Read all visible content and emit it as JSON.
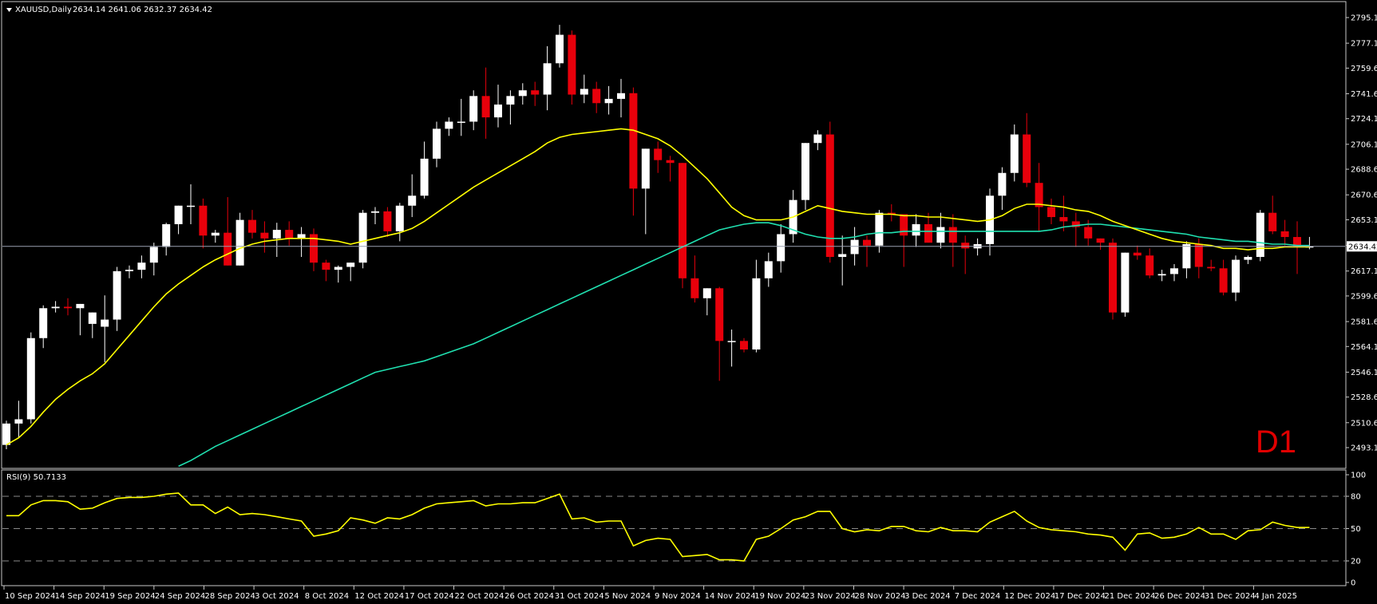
{
  "header": {
    "symbol_tf": "XAUUSD,Daily",
    "ohlc": "2634.14 2641.06 2632.37 2634.42"
  },
  "timeframe_badge": "D1",
  "current_price_label": "2634.42",
  "rsi_header": "RSI(9) 50.7133",
  "colors": {
    "background": "#000000",
    "frame": "#c8c8c8",
    "bull": "#ffffff",
    "bear": "#e8000b",
    "ma_fast": "#ffff00",
    "ma_slow": "#20e0b0",
    "rsi": "#ffff00",
    "badge": "#e00000"
  },
  "price_axis_labels": [
    "2795.10",
    "2777.10",
    "2759.60",
    "2741.60",
    "2724.10",
    "2706.10",
    "2688.60",
    "2670.60",
    "2653.10",
    "2635.10",
    "2617.10",
    "2599.60",
    "2581.60",
    "2564.10",
    "2546.10",
    "2528.60",
    "2510.60",
    "2493.10"
  ],
  "rsi_axis_labels": [
    "100",
    "80",
    "50",
    "20",
    "0"
  ],
  "time_axis_labels": [
    "10 Sep 2024",
    "14 Sep 2024",
    "19 Sep 2024",
    "24 Sep 2024",
    "28 Sep 2024",
    "3 Oct 2024",
    "8 Oct 2024",
    "12 Oct 2024",
    "17 Oct 2024",
    "22 Oct 2024",
    "26 Oct 2024",
    "31 Oct 2024",
    "5 Nov 2024",
    "9 Nov 2024",
    "14 Nov 2024",
    "19 Nov 2024",
    "23 Nov 2024",
    "28 Nov 2024",
    "3 Dec 2024",
    "7 Dec 2024",
    "12 Dec 2024",
    "17 Dec 2024",
    "21 Dec 2024",
    "26 Dec 2024",
    "31 Dec 2024",
    "4 Jan 2025"
  ],
  "chart_data": {
    "type": "candlestick",
    "symbol": "XAUUSD",
    "timeframe": "Daily",
    "price_range": [
      2493.1,
      2803
    ],
    "current_price": 2634.42,
    "candles": [
      [
        2495.0,
        2512.0,
        2492.0,
        2510.0
      ],
      [
        2510.0,
        2526.0,
        2500.0,
        2513.0
      ],
      [
        2513.0,
        2574.0,
        2510.0,
        2570.0
      ],
      [
        2570.0,
        2593.0,
        2563.0,
        2591.0
      ],
      [
        2591.0,
        2596.0,
        2588.0,
        2592.0
      ],
      [
        2592.0,
        2598.0,
        2586.0,
        2591.0
      ],
      [
        2591.0,
        2580.0,
        2572.0,
        2594.0
      ],
      [
        2580.0,
        2578.0,
        2570.0,
        2588.0
      ],
      [
        2578.0,
        2600.0,
        2553.0,
        2583.0
      ],
      [
        2583.0,
        2620.0,
        2575.0,
        2617.0
      ],
      [
        2617.0,
        2621.0,
        2612.0,
        2618.0
      ],
      [
        2618.0,
        2628.0,
        2612.0,
        2623.0
      ],
      [
        2623.0,
        2637.0,
        2614.0,
        2634.0
      ],
      [
        2634.0,
        2651.0,
        2628.0,
        2650.0
      ],
      [
        2650.0,
        2662.0,
        2643.0,
        2663.0
      ],
      [
        2663.0,
        2678.0,
        2650.0,
        2663.0
      ],
      [
        2663.0,
        2668.0,
        2633.0,
        2642.0
      ],
      [
        2642.0,
        2646.0,
        2637.0,
        2644.0
      ],
      [
        2644.0,
        2669.0,
        2630.0,
        2621.0
      ],
      [
        2621.0,
        2658.0,
        2624.0,
        2653.0
      ],
      [
        2653.0,
        2660.0,
        2640.0,
        2644.0
      ],
      [
        2644.0,
        2652.0,
        2630.0,
        2640.0
      ],
      [
        2640.0,
        2651.0,
        2627.0,
        2646.0
      ],
      [
        2646.0,
        2652.0,
        2635.0,
        2640.0
      ],
      [
        2640.0,
        2648.0,
        2627.0,
        2643.0
      ],
      [
        2643.0,
        2647.0,
        2617.0,
        2623.0
      ],
      [
        2623.0,
        2625.0,
        2610.0,
        2618.0
      ],
      [
        2618.0,
        2621.0,
        2609.0,
        2620.0
      ],
      [
        2620.0,
        2621.0,
        2610.0,
        2623.0
      ],
      [
        2623.0,
        2660.0,
        2619.0,
        2658.0
      ],
      [
        2658.0,
        2662.0,
        2650.0,
        2659.0
      ],
      [
        2659.0,
        2662.0,
        2641.0,
        2645.0
      ],
      [
        2645.0,
        2665.0,
        2638.0,
        2663.0
      ],
      [
        2663.0,
        2685.0,
        2655.0,
        2670.0
      ],
      [
        2670.0,
        2708.0,
        2668.0,
        2696.0
      ],
      [
        2696.0,
        2722.0,
        2690.0,
        2717.0
      ],
      [
        2717.0,
        2725.0,
        2712.0,
        2722.0
      ],
      [
        2722.0,
        2738.0,
        2712.0,
        2722.0
      ],
      [
        2722.0,
        2744.0,
        2716.0,
        2740.0
      ],
      [
        2740.0,
        2760.0,
        2710.0,
        2725.0
      ],
      [
        2725.0,
        2748.0,
        2718.0,
        2734.0
      ],
      [
        2734.0,
        2744.0,
        2720.0,
        2740.0
      ],
      [
        2740.0,
        2749.0,
        2734.0,
        2744.0
      ],
      [
        2744.0,
        2750.0,
        2733.0,
        2741.0
      ],
      [
        2741.0,
        2775.0,
        2730.0,
        2763.0
      ],
      [
        2763.0,
        2790.0,
        2760.0,
        2783.0
      ],
      [
        2783.0,
        2786.0,
        2734.0,
        2741.0
      ],
      [
        2741.0,
        2755.0,
        2735.0,
        2745.0
      ],
      [
        2745.0,
        2750.0,
        2728.0,
        2735.0
      ],
      [
        2735.0,
        2747.0,
        2727.0,
        2738.0
      ],
      [
        2738.0,
        2752.0,
        2725.0,
        2742.0
      ],
      [
        2742.0,
        2746.0,
        2656.0,
        2675.0
      ],
      [
        2675.0,
        2701.0,
        2643.0,
        2703.0
      ],
      [
        2703.0,
        2708.0,
        2686.0,
        2695.0
      ],
      [
        2695.0,
        2698.0,
        2680.0,
        2693.0
      ],
      [
        2693.0,
        2690.0,
        2605.0,
        2612.0
      ],
      [
        2612.0,
        2628.0,
        2595.0,
        2598.0
      ],
      [
        2598.0,
        2602.0,
        2586.0,
        2605.0
      ],
      [
        2605.0,
        2606.0,
        2540.0,
        2568.0
      ],
      [
        2568.0,
        2576.0,
        2550.0,
        2568.0
      ],
      [
        2568.0,
        2570.0,
        2560.0,
        2562.0
      ],
      [
        2562.0,
        2625.0,
        2560.0,
        2612.0
      ],
      [
        2612.0,
        2630.0,
        2606.0,
        2624.0
      ],
      [
        2624.0,
        2650.0,
        2616.0,
        2643.0
      ],
      [
        2643.0,
        2674.0,
        2637.0,
        2667.0
      ],
      [
        2667.0,
        2705.0,
        2660.0,
        2707.0
      ],
      [
        2707.0,
        2716.0,
        2702.0,
        2713.0
      ],
      [
        2713.0,
        2722.0,
        2623.0,
        2627.0
      ],
      [
        2627.0,
        2642.0,
        2607.0,
        2629.0
      ],
      [
        2629.0,
        2648.0,
        2621.0,
        2639.0
      ],
      [
        2639.0,
        2642.0,
        2620.0,
        2635.0
      ],
      [
        2635.0,
        2660.0,
        2630.0,
        2658.0
      ],
      [
        2658.0,
        2664.0,
        2652.0,
        2657.0
      ],
      [
        2657.0,
        2651.0,
        2620.0,
        2642.0
      ],
      [
        2642.0,
        2657.0,
        2634.0,
        2650.0
      ],
      [
        2650.0,
        2658.0,
        2640.0,
        2637.0
      ],
      [
        2637.0,
        2658.0,
        2633.0,
        2648.0
      ],
      [
        2648.0,
        2657.0,
        2620.0,
        2637.0
      ],
      [
        2637.0,
        2642.0,
        2615.0,
        2633.0
      ],
      [
        2633.0,
        2640.0,
        2628.0,
        2636.0
      ],
      [
        2636.0,
        2675.0,
        2628.0,
        2670.0
      ],
      [
        2670.0,
        2690.0,
        2660.0,
        2686.0
      ],
      [
        2686.0,
        2720.0,
        2680.0,
        2713.0
      ],
      [
        2713.0,
        2728.0,
        2676.0,
        2679.0
      ],
      [
        2679.0,
        2693.0,
        2645.0,
        2662.0
      ],
      [
        2662.0,
        2668.0,
        2650.0,
        2655.0
      ],
      [
        2655.0,
        2670.0,
        2645.0,
        2652.0
      ],
      [
        2652.0,
        2658.0,
        2634.0,
        2648.0
      ],
      [
        2648.0,
        2653.0,
        2635.0,
        2640.0
      ],
      [
        2640.0,
        2640.0,
        2632.0,
        2637.0
      ],
      [
        2637.0,
        2640.0,
        2583.0,
        2588.0
      ],
      [
        2588.0,
        2630.0,
        2585.0,
        2630.0
      ],
      [
        2630.0,
        2635.0,
        2625.0,
        2628.0
      ],
      [
        2628.0,
        2633.0,
        2612.0,
        2614.0
      ],
      [
        2614.0,
        2618.0,
        2610.0,
        2615.0
      ],
      [
        2615.0,
        2622.0,
        2610.0,
        2619.0
      ],
      [
        2619.0,
        2638.0,
        2612.0,
        2636.0
      ],
      [
        2636.0,
        2640.0,
        2612.0,
        2620.0
      ],
      [
        2620.0,
        2625.0,
        2617.0,
        2619.0
      ],
      [
        2619.0,
        2625.0,
        2600.0,
        2602.0
      ],
      [
        2602.0,
        2628.0,
        2596.0,
        2625.0
      ],
      [
        2625.0,
        2628.0,
        2622.0,
        2627.0
      ],
      [
        2627.0,
        2660.0,
        2624.0,
        2658.0
      ],
      [
        2658.0,
        2670.0,
        2643.0,
        2645.0
      ],
      [
        2645.0,
        2653.0,
        2635.0,
        2641.0
      ],
      [
        2641.0,
        2652.0,
        2615.0,
        2634.0
      ],
      [
        2634.14,
        2641.06,
        2632.37,
        2634.42
      ]
    ],
    "ma_fast_values": [
      2495,
      2500,
      2508,
      2518,
      2527,
      2534,
      2540,
      2545,
      2552,
      2562,
      2572,
      2582,
      2592,
      2601,
      2608,
      2614,
      2620,
      2625,
      2629,
      2633,
      2636,
      2638,
      2639,
      2640,
      2640,
      2640,
      2639,
      2638,
      2636,
      2638,
      2640,
      2642,
      2644,
      2647,
      2652,
      2658,
      2664,
      2670,
      2676,
      2681,
      2686,
      2691,
      2696,
      2701,
      2707,
      2711,
      2713,
      2714,
      2715,
      2716,
      2717,
      2716,
      2713,
      2710,
      2705,
      2698,
      2690,
      2682,
      2672,
      2662,
      2656,
      2653,
      2653,
      2653,
      2655,
      2659,
      2663,
      2661,
      2659,
      2658,
      2657,
      2657,
      2657,
      2656,
      2656,
      2655,
      2655,
      2654,
      2653,
      2652,
      2653,
      2656,
      2661,
      2664,
      2664,
      2663,
      2662,
      2660,
      2659,
      2656,
      2652,
      2649,
      2646,
      2643,
      2640,
      2638,
      2637,
      2636,
      2635,
      2633,
      2633,
      2632,
      2633,
      2633,
      2634,
      2634,
      2634
    ],
    "ma_slow_values": [
      2480,
      2484,
      2489,
      2494,
      2498,
      2502,
      2506,
      2510,
      2514,
      2518,
      2522,
      2526,
      2530,
      2534,
      2538,
      2542,
      2546,
      2548,
      2550,
      2552,
      2554,
      2557,
      2560,
      2563,
      2566,
      2570,
      2574,
      2578,
      2582,
      2586,
      2590,
      2594,
      2598,
      2602,
      2606,
      2610,
      2614,
      2618,
      2622,
      2626,
      2630,
      2634,
      2638,
      2642,
      2646,
      2648,
      2650,
      2651,
      2651,
      2649,
      2646,
      2643,
      2641,
      2640,
      2640,
      2641,
      2643,
      2644,
      2644,
      2645,
      2645,
      2645,
      2645,
      2645,
      2645,
      2645,
      2645,
      2645,
      2645,
      2645,
      2645,
      2646,
      2648,
      2649,
      2650,
      2650,
      2649,
      2648,
      2647,
      2646,
      2645,
      2644,
      2643,
      2641,
      2640,
      2639,
      2638,
      2638,
      2637,
      2636,
      2636,
      2635,
      2635
    ],
    "rsi": {
      "period": 9,
      "value": 50.7133,
      "levels": [
        20,
        50,
        80
      ],
      "range": [
        0,
        100
      ],
      "values": [
        62,
        62,
        72,
        76,
        76,
        75,
        68,
        69,
        74,
        78,
        79,
        79,
        80,
        82,
        83,
        72,
        72,
        64,
        70,
        63,
        64,
        63,
        61,
        59,
        57,
        43,
        45,
        48,
        60,
        58,
        55,
        60,
        59,
        63,
        69,
        73,
        74,
        75,
        76,
        71,
        73,
        73,
        74,
        74,
        78,
        82,
        59,
        60,
        56,
        57,
        57,
        34,
        39,
        41,
        40,
        24,
        25,
        26,
        21,
        21,
        20,
        40,
        43,
        50,
        58,
        61,
        66,
        66,
        50,
        47,
        49,
        48,
        52,
        52,
        48,
        47,
        51,
        48,
        48,
        47,
        56,
        61,
        66,
        57,
        51,
        49,
        48,
        47,
        45,
        44,
        42,
        30,
        45,
        46,
        41,
        42,
        45,
        51,
        45,
        45,
        40,
        48,
        49,
        56,
        53,
        51,
        51
      ]
    }
  }
}
